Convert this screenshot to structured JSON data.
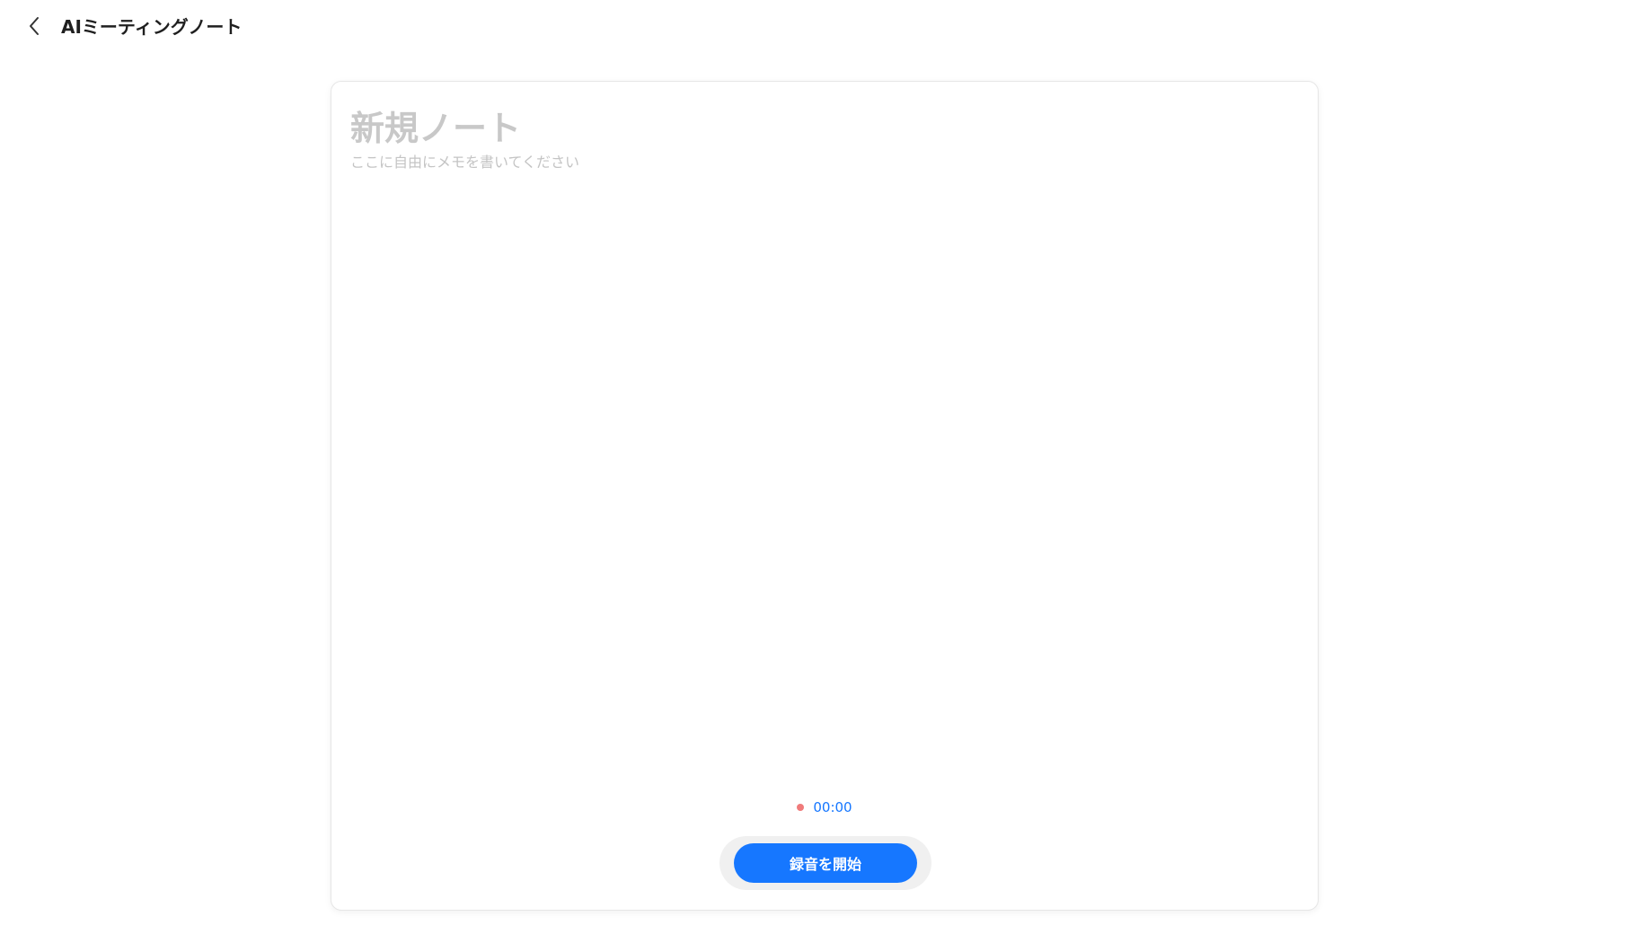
{
  "header": {
    "back_icon": "chevron-left-icon",
    "title": "AIミーティングノート"
  },
  "note": {
    "title_placeholder": "新規ノート",
    "title_value": "",
    "body_placeholder": "ここに自由にメモを書いてください",
    "body_value": ""
  },
  "recorder": {
    "status_dot_color": "#f07b7b",
    "elapsed": "00:00",
    "start_label": "録音を開始",
    "accent_color": "#1677ff"
  }
}
